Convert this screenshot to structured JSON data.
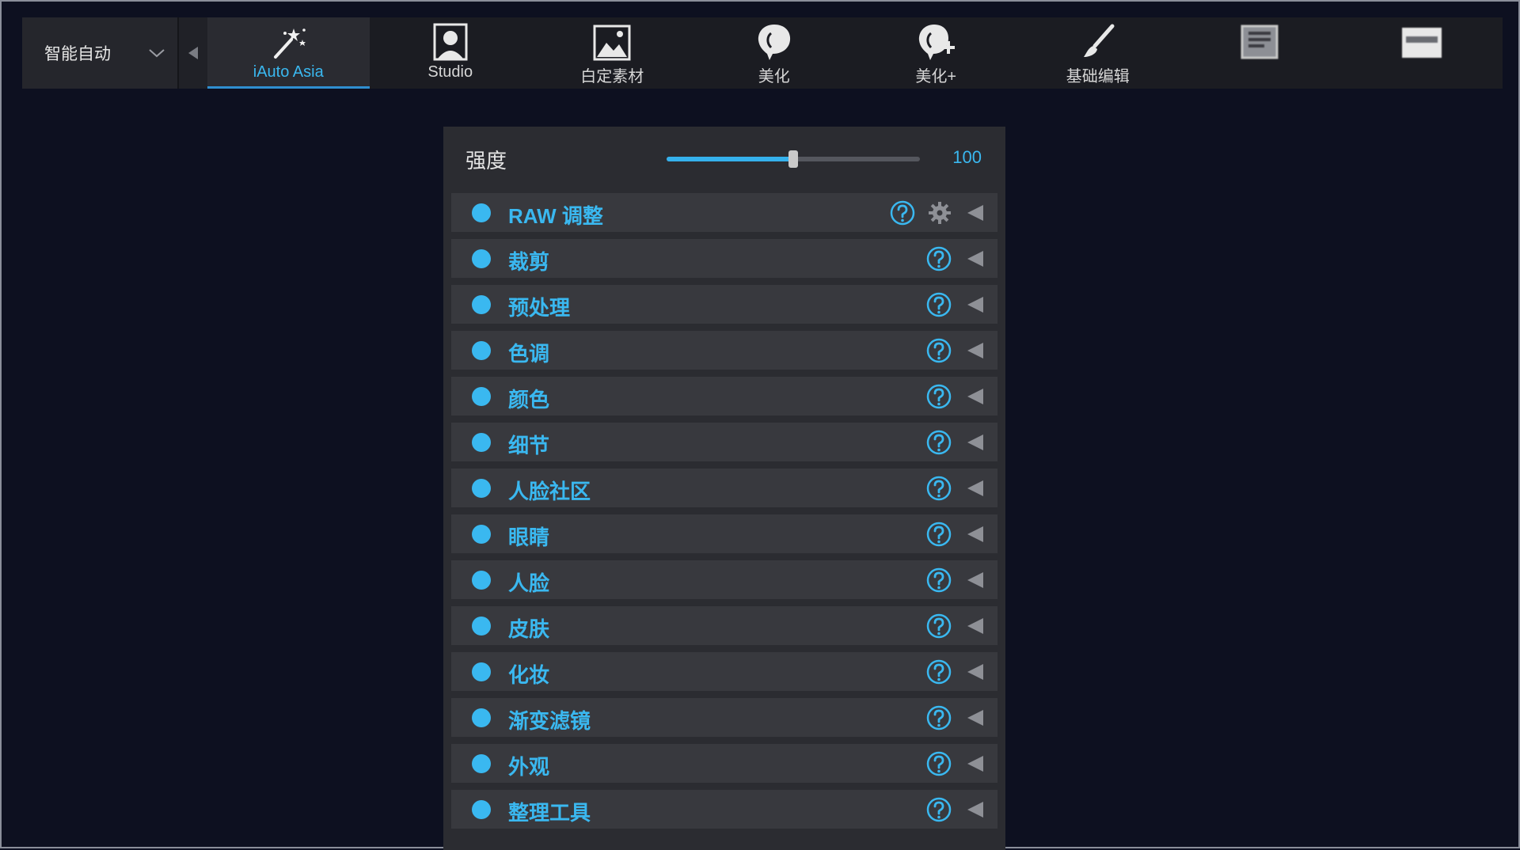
{
  "toolbar": {
    "mode_select": {
      "label": "智能自动"
    },
    "tabs": [
      {
        "label": "iAuto Asia",
        "icon": "magic-wand-icon",
        "active": true
      },
      {
        "label": "Studio",
        "icon": "portrait-icon",
        "active": false
      },
      {
        "label": "白定素材",
        "icon": "landscape-image-icon",
        "active": false
      },
      {
        "label": "美化",
        "icon": "face-profile-icon",
        "active": false
      },
      {
        "label": "美化+",
        "icon": "face-profile-plus-icon",
        "active": false
      },
      {
        "label": "基础编辑",
        "icon": "brush-icon",
        "active": false
      },
      {
        "label": "",
        "icon": "document-icon",
        "active": false
      },
      {
        "label": "",
        "icon": "window-icon",
        "active": false
      }
    ]
  },
  "strength": {
    "label": "强度",
    "value": "100",
    "slider_fraction": 0.5
  },
  "modules": [
    {
      "label": "RAW 调整",
      "has_gear": true
    },
    {
      "label": "裁剪",
      "has_gear": false
    },
    {
      "label": "预处理",
      "has_gear": false
    },
    {
      "label": "色调",
      "has_gear": false
    },
    {
      "label": "颜色",
      "has_gear": false
    },
    {
      "label": "细节",
      "has_gear": false
    },
    {
      "label": "人脸社区",
      "has_gear": false
    },
    {
      "label": "眼睛",
      "has_gear": false
    },
    {
      "label": "人脸",
      "has_gear": false
    },
    {
      "label": "皮肤",
      "has_gear": false
    },
    {
      "label": "化妆",
      "has_gear": false
    },
    {
      "label": "渐变滤镜",
      "has_gear": false
    },
    {
      "label": "外观",
      "has_gear": false
    },
    {
      "label": "整理工具",
      "has_gear": false
    }
  ],
  "colors": {
    "accent": "#3ab8f0",
    "background": "#0d1020",
    "panel": "#2b2c31",
    "row": "#38393e"
  }
}
